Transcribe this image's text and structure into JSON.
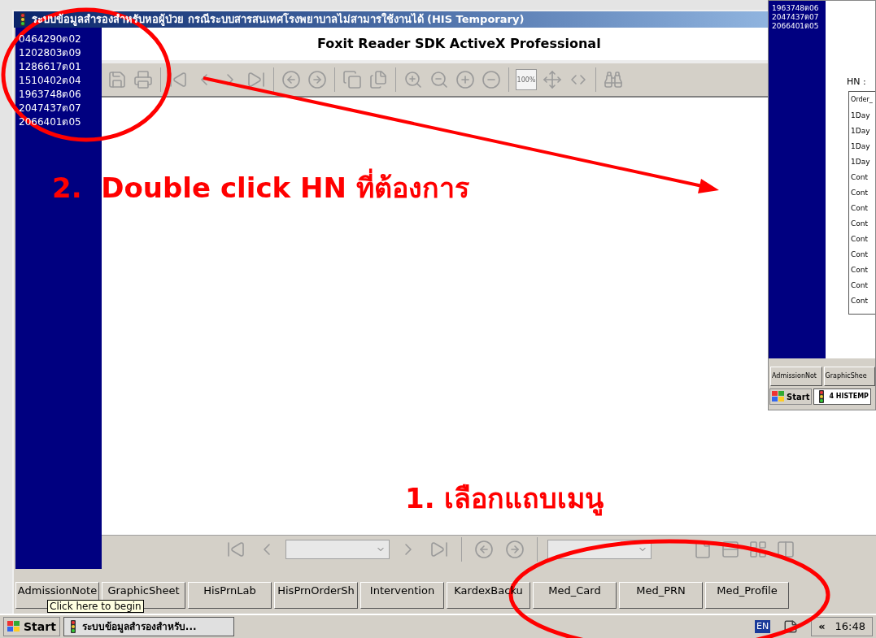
{
  "window": {
    "title": "ระบบข้อมูลสำรองสำหรับหอผู้ป่วย กรณีระบบสารสนเทศโรงพยาบาลไม่สามารใช้งานได้ (HIS Temporary)"
  },
  "hn_list": [
    "0464290ต02",
    "1202803ต09",
    "1286617ต01",
    "1510402ต04",
    "1963748ต06",
    "2047437ต07",
    "2066401ต05"
  ],
  "viewer": {
    "title": "Foxit Reader SDK ActiveX Professional",
    "zoom_100_label": "100%"
  },
  "tabs": [
    "AdmissionNote",
    "GraphicSheet",
    "HisPrnLab",
    "HisPrnOrderSh",
    "Intervention",
    "KardexBacku",
    "Med_Card",
    "Med_PRN",
    "Med_Profile"
  ],
  "tooltip": "Click here to begin",
  "taskbar": {
    "start": "Start",
    "task": "ระบบข้อมูลสำรองสำหรับ...",
    "language": "EN",
    "collapse": "«",
    "time": "16:48"
  },
  "inset": {
    "hn_list": [
      "1963748ต06",
      "2047437ต07",
      "2066401ต05"
    ],
    "hn_label": "HN :",
    "column": "Order_",
    "rows": [
      "1Day",
      "1Day",
      "1Day",
      "1Day",
      "Cont",
      "Cont",
      "Cont",
      "Cont",
      "Cont",
      "Cont",
      "Cont",
      "Cont",
      "Cont"
    ],
    "tabs": [
      "AdmissionNot",
      "GraphicShee"
    ],
    "start": "Start",
    "task": "4 HISTEMP"
  },
  "annotations": [
    {
      "text": "2.  Double click HN ที่ต้องการ"
    },
    {
      "text": "1. เลือกแถบเมนู"
    }
  ]
}
